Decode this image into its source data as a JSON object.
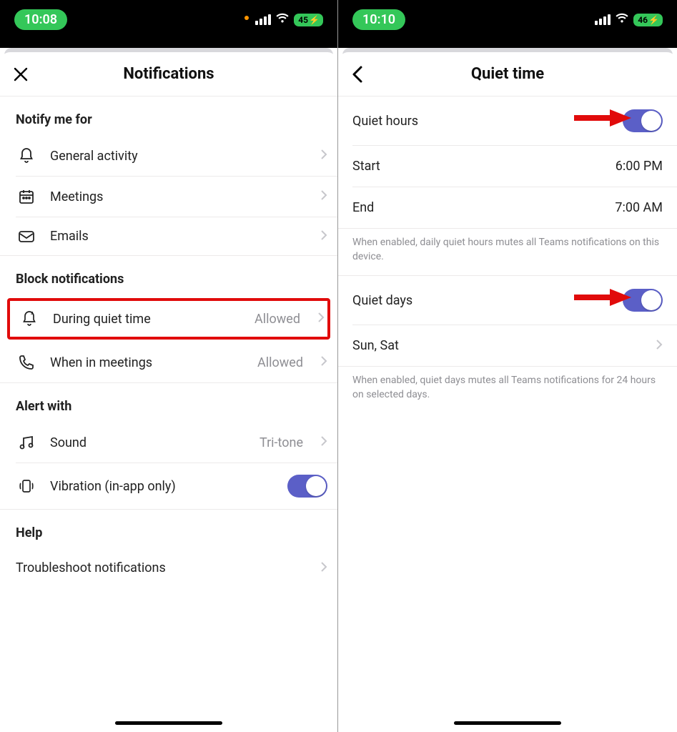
{
  "leftPhone": {
    "status": {
      "time": "10:08",
      "battery": "45"
    },
    "header": {
      "title": "Notifications"
    },
    "sections": {
      "notifyTitle": "Notify me for",
      "notifyItems": {
        "general": "General activity",
        "meetings": "Meetings",
        "emails": "Emails"
      },
      "blockTitle": "Block notifications",
      "blockItems": {
        "quietTime": {
          "label": "During quiet time",
          "value": "Allowed"
        },
        "inMeetings": {
          "label": "When in meetings",
          "value": "Allowed"
        }
      },
      "alertTitle": "Alert with",
      "alertItems": {
        "sound": {
          "label": "Sound",
          "value": "Tri-tone"
        },
        "vibration": {
          "label": "Vibration (in-app only)",
          "on": true
        }
      },
      "helpTitle": "Help",
      "helpItems": {
        "troubleshoot": "Troubleshoot notifications"
      }
    }
  },
  "rightPhone": {
    "status": {
      "time": "10:10",
      "battery": "46"
    },
    "header": {
      "title": "Quiet time"
    },
    "quietHours": {
      "label": "Quiet hours",
      "on": true,
      "startLabel": "Start",
      "startVal": "6:00 PM",
      "endLabel": "End",
      "endVal": "7:00 AM",
      "helper": "When enabled, daily quiet hours mutes all Teams notifications on this device."
    },
    "quietDays": {
      "label": "Quiet days",
      "on": true,
      "daysLabel": "Sun, Sat",
      "helper": "When enabled, quiet days mutes all Teams notifications for 24 hours on selected days."
    }
  }
}
